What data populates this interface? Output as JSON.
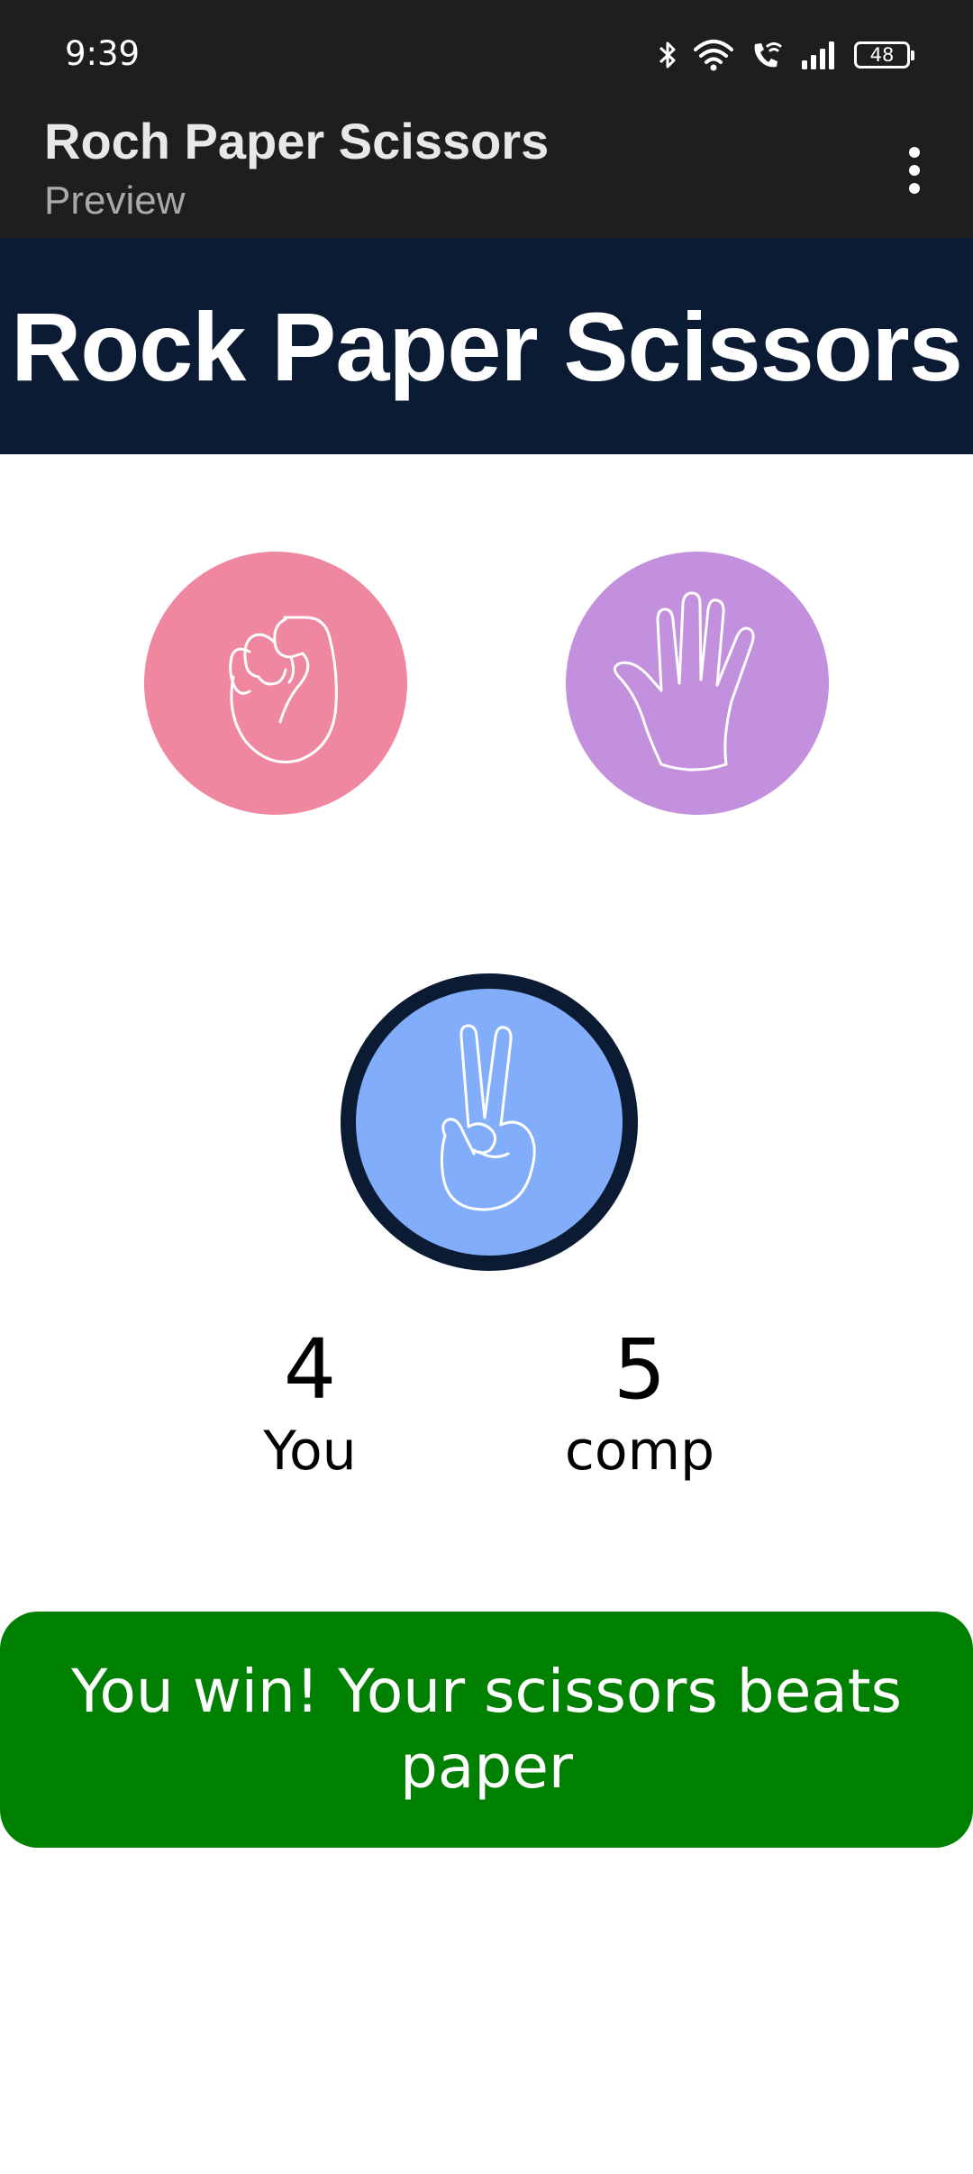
{
  "status_bar": {
    "time": "9:39",
    "battery": "48",
    "icons": [
      "bluetooth-icon",
      "wifi-icon",
      "wifi-calling-icon",
      "signal-icon",
      "battery-icon"
    ]
  },
  "app_bar": {
    "title": "Roch Paper Scissors",
    "subtitle": "Preview",
    "menu_icon": "more-vert-icon"
  },
  "header": {
    "title": "Rock Paper Scissors",
    "background": "#0a1b33"
  },
  "choices": [
    {
      "name": "rock",
      "icon": "fist-icon",
      "color": "#ef87a0"
    },
    {
      "name": "paper",
      "icon": "open-hand-icon",
      "color": "#c290dc"
    },
    {
      "name": "scissors",
      "icon": "peace-hand-icon",
      "color": "#82adfb",
      "selected": true
    }
  ],
  "scores": {
    "you": {
      "value": "4",
      "label": "You"
    },
    "comp": {
      "value": "5",
      "label": "comp"
    }
  },
  "result": {
    "text": "You win! Your scissors beats paper",
    "color": "#008000"
  }
}
